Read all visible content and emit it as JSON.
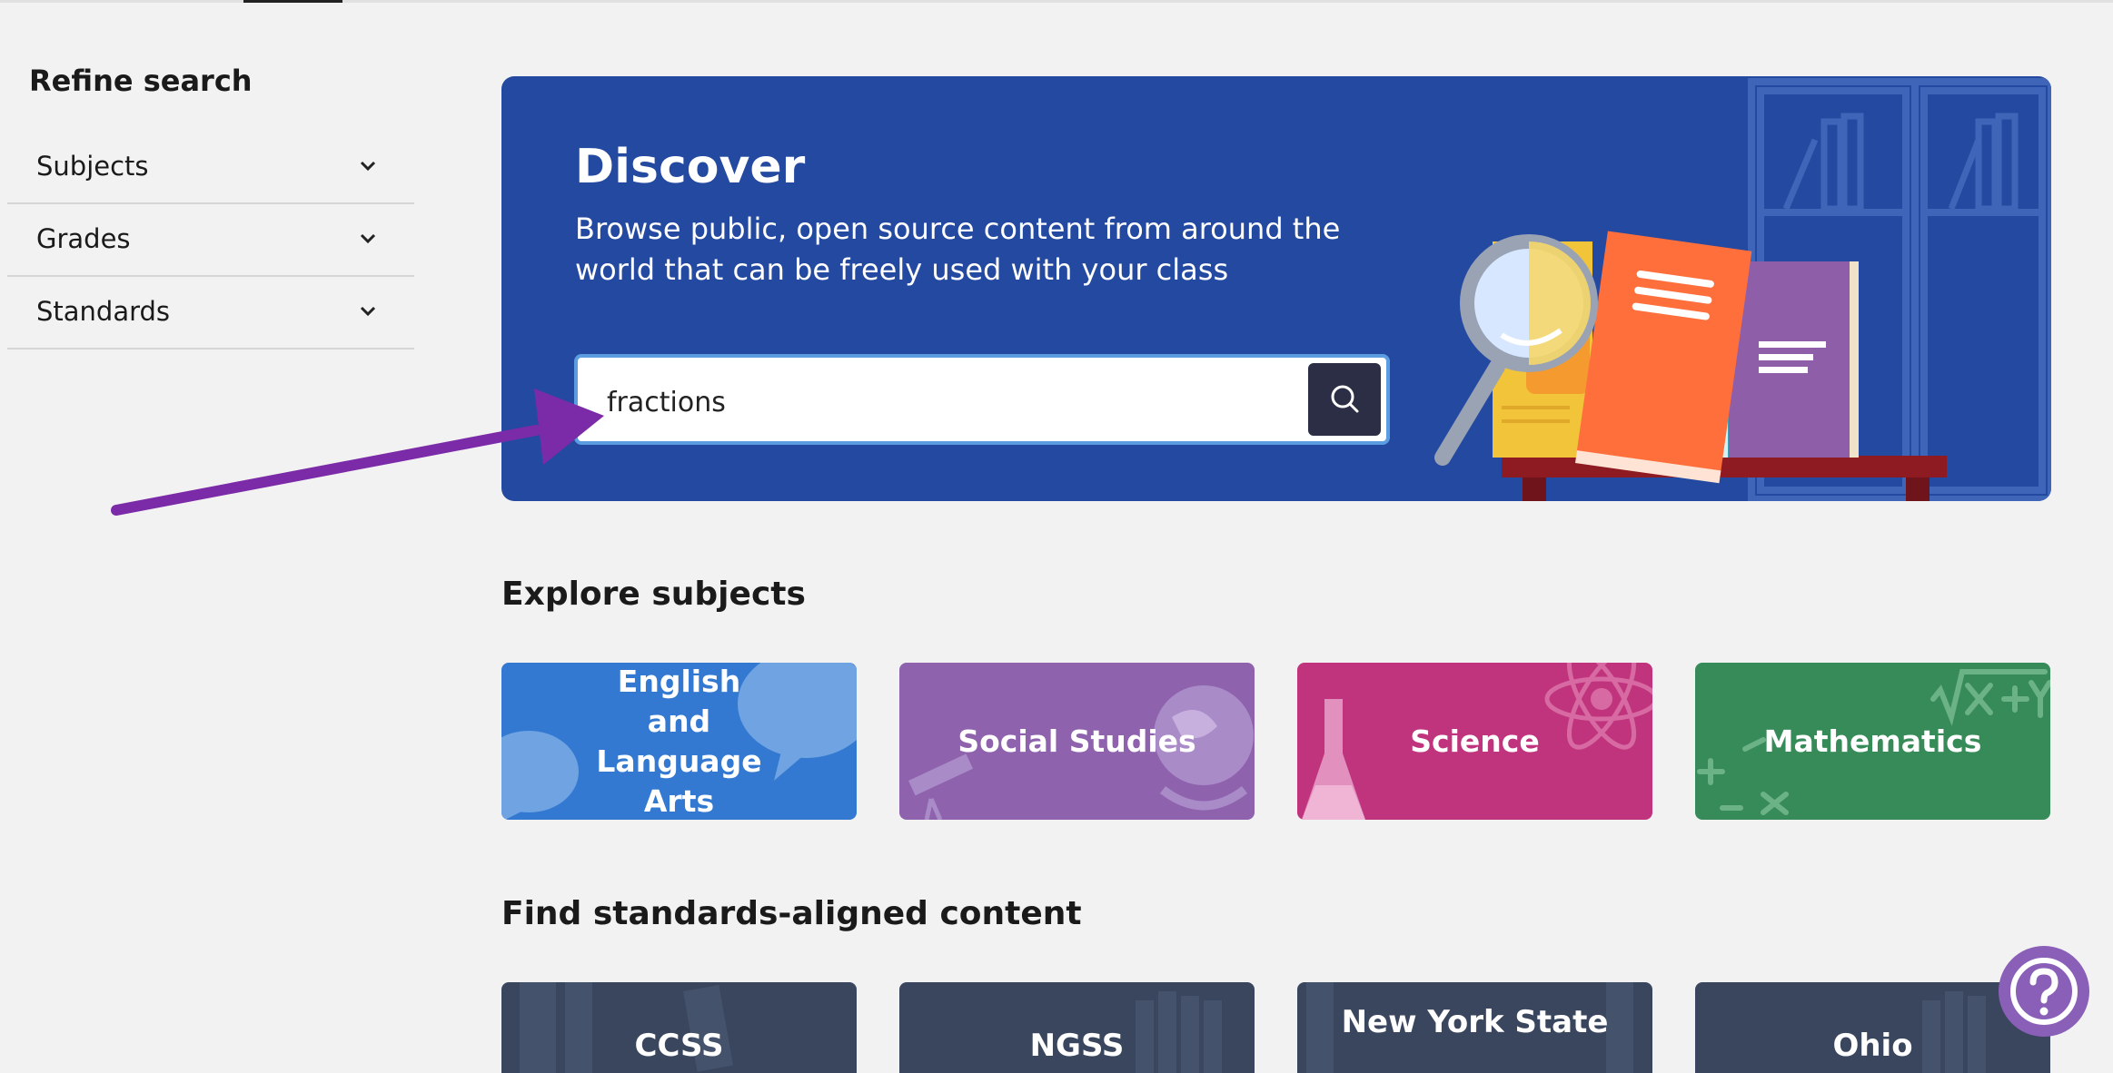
{
  "sidebar": {
    "title": "Refine search",
    "filters": [
      {
        "label": "Subjects"
      },
      {
        "label": "Grades"
      },
      {
        "label": "Standards"
      }
    ]
  },
  "hero": {
    "title": "Discover",
    "description": "Browse public, open source content from around the world that can be freely used with your class",
    "search": {
      "value": "fractions",
      "icon": "search-icon"
    }
  },
  "explore": {
    "title": "Explore subjects",
    "subjects": [
      {
        "label": "English and Language Arts",
        "color": "#3479d1"
      },
      {
        "label": "Social Studies",
        "color": "#8e62ad"
      },
      {
        "label": "Science",
        "color": "#c0347e"
      },
      {
        "label": "Mathematics",
        "color": "#378b58"
      }
    ]
  },
  "standards": {
    "title": "Find standards-aligned content",
    "items": [
      {
        "label": "CCSS"
      },
      {
        "label": "NGSS"
      },
      {
        "label": "New York State"
      },
      {
        "label": "Ohio"
      }
    ]
  },
  "help": {
    "icon": "question-icon"
  },
  "colors": {
    "hero": "#2449a0",
    "annotation_arrow": "#7b2aa8",
    "help": "#8a5fb8"
  }
}
